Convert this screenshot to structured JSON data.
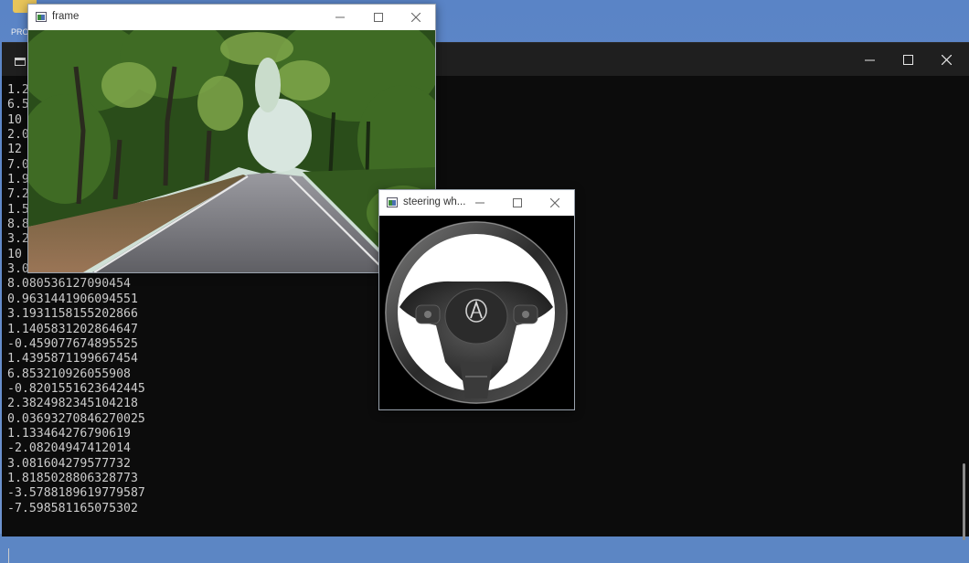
{
  "desktop": {
    "icon_label": "PRO"
  },
  "terminal": {
    "lines": [
      "1.2",
      "6.5",
      "10",
      "2.0",
      "12",
      "7.0",
      "1.9",
      "7.2",
      "1.5",
      "8.8",
      "3.2",
      "10",
      "3.0",
      "8.080536127090454",
      "0.9631441906094551",
      "3.1931158155202866",
      "1.1405831202864647",
      "-0.459077674895525",
      "1.4395871199667454",
      "6.853210926055908",
      "-0.8201551623642445",
      "2.3824982345104218",
      "0.03693270846270025",
      "1.133464276790619",
      "-2.08204947412014",
      "3.081604279577732",
      "1.8185028806328773",
      "-3.5788189619779587",
      "-7.598581165075302"
    ]
  },
  "frame_window": {
    "title": "frame",
    "scene": {
      "sky": "#cfe0d6",
      "foliage_dark": "#1e3b14",
      "foliage_mid": "#3f6b24",
      "foliage_light": "#7fa64a",
      "road": "#6e6e72",
      "road_edge": "#e9e9e9",
      "dirt": "#8a6a4a"
    }
  },
  "steering_window": {
    "title": "steering wh..."
  },
  "icons": {
    "minimize": "minimize-icon",
    "maximize": "maximize-icon",
    "close": "close-icon"
  }
}
